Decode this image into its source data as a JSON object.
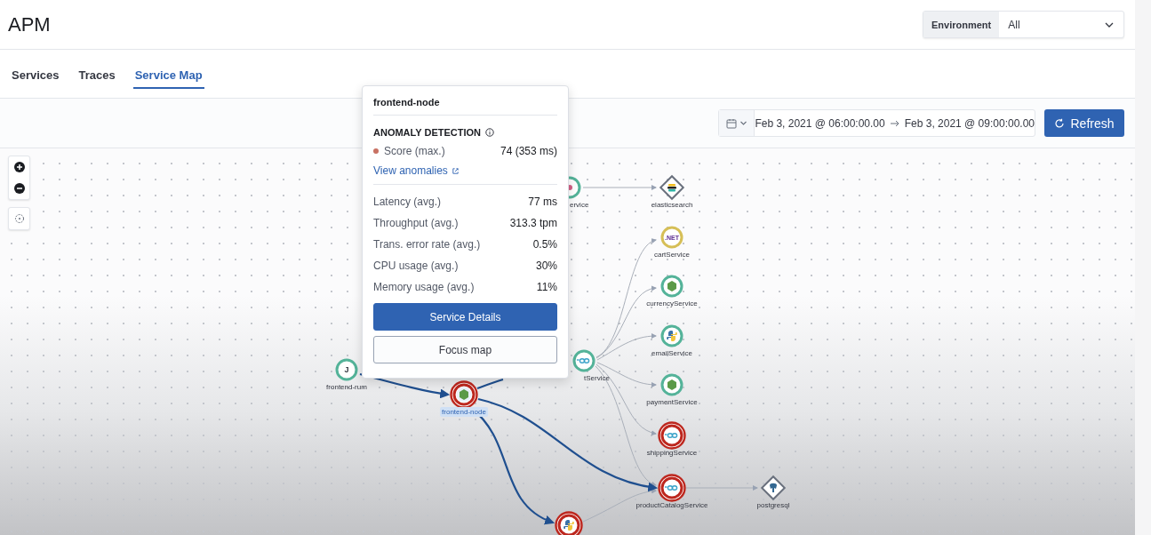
{
  "header": {
    "title": "APM",
    "environment": {
      "label": "Environment",
      "value": "All"
    }
  },
  "tabs": [
    {
      "label": "Services",
      "selected": false
    },
    {
      "label": "Traces",
      "selected": false
    },
    {
      "label": "Service Map",
      "selected": true
    }
  ],
  "date_range": {
    "start": "Feb 3, 2021 @ 06:00:00.00",
    "end": "Feb 3, 2021 @ 09:00:00.00",
    "refresh_button": "Refresh"
  },
  "map": {
    "nodes": [
      {
        "kind": "service",
        "label": "ervice",
        "color": "#54b399",
        "critical": false
      },
      {
        "kind": "database",
        "label": "elasticsearch"
      },
      {
        "kind": "service",
        "label": "cartService",
        "color": "#d6bf57",
        "critical": false,
        "icon_text": ".NET"
      },
      {
        "kind": "service",
        "label": "currencyService",
        "color": "#54b399",
        "critical": false
      },
      {
        "kind": "service",
        "label": "emailService",
        "color": "#54b399",
        "critical": false
      },
      {
        "kind": "service",
        "label": "paymentService",
        "color": "#54b399",
        "critical": false
      },
      {
        "kind": "service",
        "label": "shippingService",
        "color": "#bd271e",
        "critical": true
      },
      {
        "kind": "service",
        "label": "productCatalogService",
        "color": "#bd271e",
        "critical": true
      },
      {
        "kind": "database",
        "label": "postgresql"
      },
      {
        "kind": "service",
        "label": "tService",
        "color": "#54b399",
        "critical": false
      },
      {
        "kind": "service",
        "label": "frontend-rum",
        "color": "#54b399",
        "critical": false,
        "icon_text": "J"
      },
      {
        "kind": "service",
        "label": "frontend-node",
        "color": "#bd271e",
        "critical": true,
        "selected": true
      },
      {
        "kind": "service",
        "color": "#bd271e",
        "critical": true
      }
    ],
    "popover": {
      "title": "frontend-node",
      "anomaly_heading": "ANOMALY DETECTION",
      "score_label": "Score (max.)",
      "score_value": "74 (353 ms)",
      "link": "View anomalies",
      "metrics": [
        {
          "label": "Latency (avg.)",
          "value": "77 ms"
        },
        {
          "label": "Throughput (avg.)",
          "value": "313.3 tpm"
        },
        {
          "label": "Trans. error rate (avg.)",
          "value": "0.5%"
        },
        {
          "label": "CPU usage (avg.)",
          "value": "30%"
        },
        {
          "label": "Memory usage (avg.)",
          "value": "11%"
        }
      ],
      "buttons": [
        {
          "label": "Service Details",
          "kind": "primary"
        },
        {
          "label": "Focus map",
          "kind": "secondary"
        }
      ]
    }
  }
}
